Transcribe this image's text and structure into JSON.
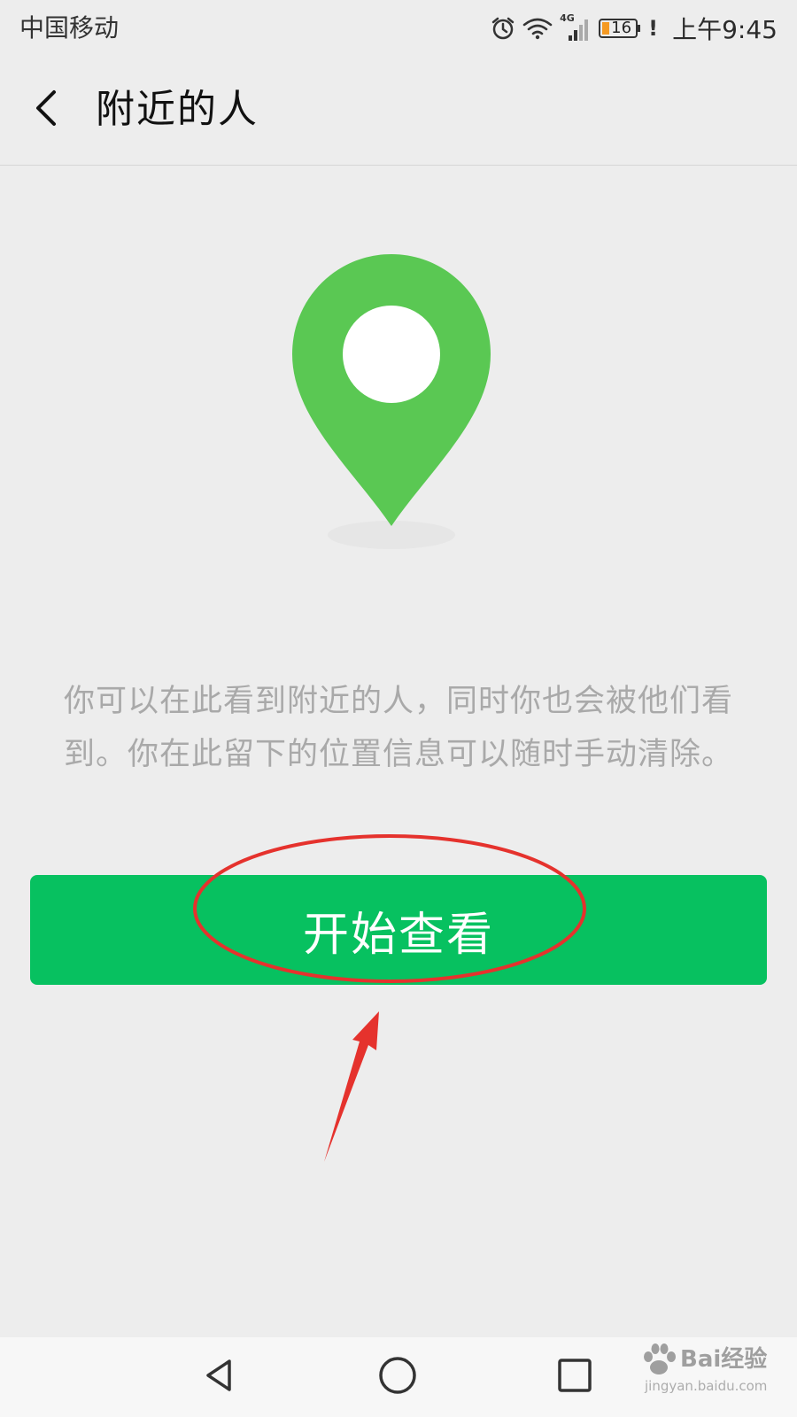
{
  "status_bar": {
    "carrier": "中国移动",
    "network": "4G",
    "battery": "16",
    "alert": "!",
    "time": "上午9:45"
  },
  "header": {
    "title": "附近的人"
  },
  "main": {
    "description": "你可以在此看到附近的人，同时你也会被他们看到。你在此留下的位置信息可以随时手动清除。",
    "primary_button_label": "开始查看"
  },
  "watermark": {
    "brand": "Bai经验",
    "url": "jingyan.baidu.com"
  },
  "colors": {
    "accent_green": "#07c160",
    "pin_green": "#5ac853",
    "annotation_red": "#e5322d",
    "background": "#ededed"
  },
  "icons": {
    "back": "chevron-left-icon",
    "pin": "location-pin-icon",
    "nav_back": "triangle-back-icon",
    "nav_home": "circle-home-icon",
    "nav_recent": "square-recents-icon"
  }
}
